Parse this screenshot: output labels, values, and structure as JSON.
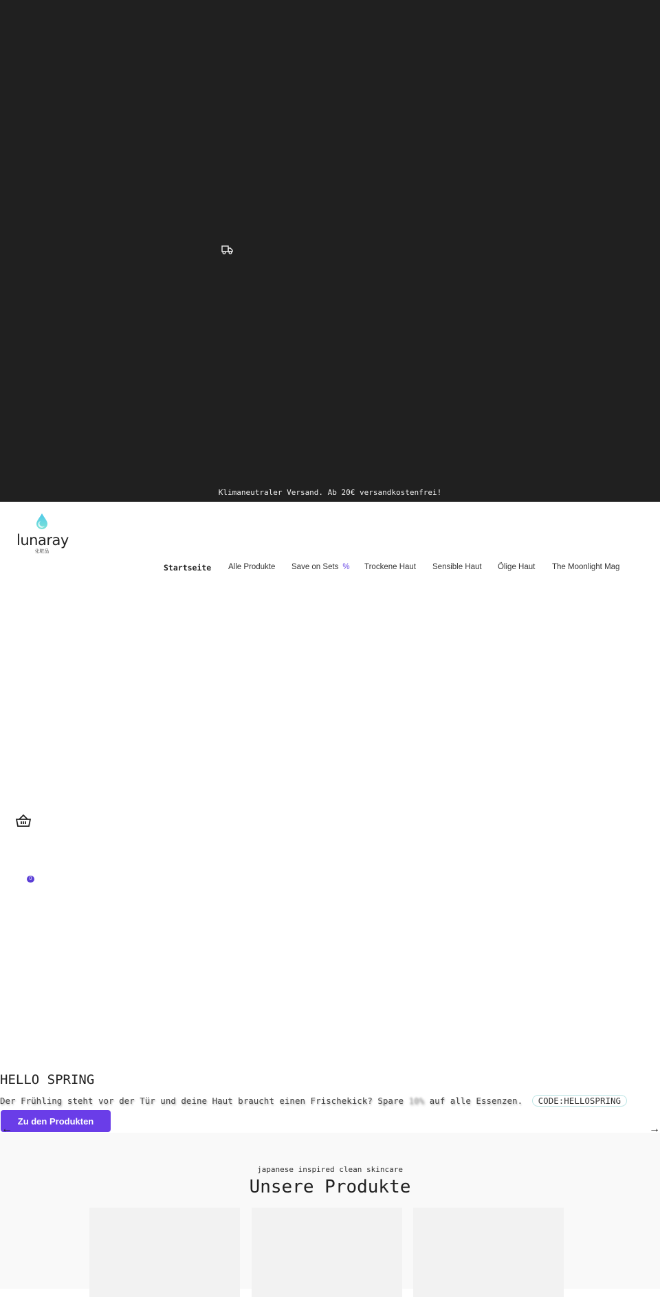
{
  "announcement": {
    "text": "Klimaneutraler Versand. Ab 20€ versandkostenfrei!",
    "icon": "truck-icon"
  },
  "logo": {
    "word": "lunaray",
    "sub": "化粧品",
    "drop_color": "#5fd3e6"
  },
  "nav": {
    "items": [
      {
        "label": "Startseite",
        "active": true
      },
      {
        "label": "Alle Produkte"
      },
      {
        "label": "Save on Sets",
        "badge": "%"
      },
      {
        "label": "Trockene Haut"
      },
      {
        "label": "Sensible Haut"
      },
      {
        "label": "Ölige Haut"
      },
      {
        "label": "The Moonlight Mag"
      }
    ]
  },
  "cart": {
    "icon": "basket-icon",
    "count": "0"
  },
  "hero": {
    "title": "HELLO SPRING",
    "text_before": "Der Frühling steht vor der Tür und deine Haut braucht einen Frischekick? Spare",
    "discount": "10%",
    "text_after": "auf alle Essenzen.",
    "code": "CODE:HELLOSPRING",
    "cta": "Zu den Produkten",
    "prev": "←",
    "next": "→"
  },
  "products": {
    "kicker": "japanese inspired clean skincare",
    "heading": "Unsere Produkte"
  },
  "colors": {
    "accent": "#6a3de8",
    "topbar": "#202020",
    "section_bg": "#f9f9f9"
  }
}
